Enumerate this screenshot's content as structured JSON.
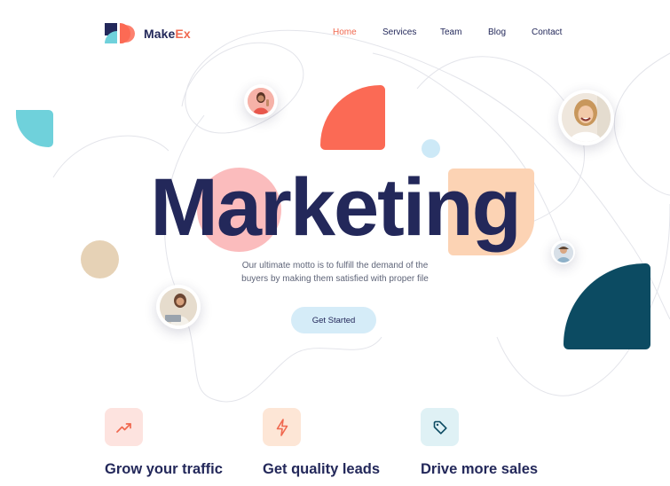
{
  "brand": {
    "name_part1": "Make",
    "name_part2": "Ex"
  },
  "nav": {
    "items": [
      {
        "label": "Home",
        "active": true
      },
      {
        "label": "Services",
        "active": false
      },
      {
        "label": "Team",
        "active": false
      },
      {
        "label": "Blog",
        "active": false
      },
      {
        "label": "Contact",
        "active": false
      }
    ]
  },
  "hero": {
    "title": "Marketing",
    "subtitle_line1": "Our ultimate motto is to fulfill the demand of the",
    "subtitle_line2": "buyers by making them satisfied with proper file",
    "cta_label": "Get Started"
  },
  "features": [
    {
      "title": "Grow your traffic",
      "icon": "trending-up-icon",
      "tile_color": "#fde3df",
      "icon_color": "#f0684f"
    },
    {
      "title": "Get quality leads",
      "icon": "lightning-icon",
      "tile_color": "#fde6d6",
      "icon_color": "#f0684f"
    },
    {
      "title": "Drive more sales",
      "icon": "tag-icon",
      "tile_color": "#dff1f5",
      "icon_color": "#0c4b62"
    }
  ],
  "colors": {
    "navy": "#23285a",
    "accent": "#f0684f",
    "teal": "#6fd1db",
    "dark_teal": "#0c4b62",
    "peach": "#fcd3b4",
    "pink": "#fbbcbd",
    "tan": "#e6d2b6",
    "light_blue": "#d5ecf8"
  }
}
